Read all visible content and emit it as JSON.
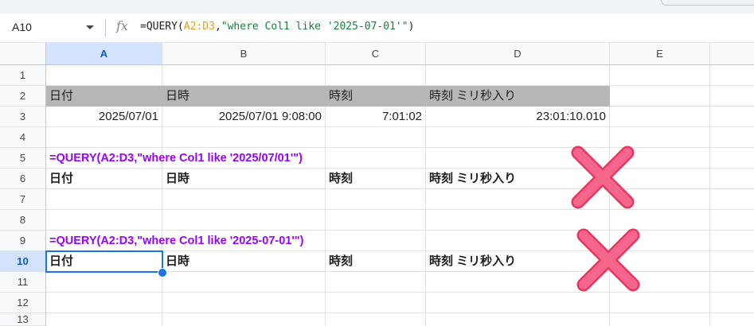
{
  "name_box": "A10",
  "formula_bar": {
    "fx_icon": "fx-icon",
    "prefix": "=QUERY(",
    "range": "A2:D3",
    "comma": ",",
    "query_string": "\"where Col1 like '2025-07-01'\"",
    "suffix": ")"
  },
  "columns": [
    "A",
    "B",
    "C",
    "D",
    "E"
  ],
  "rows": [
    "1",
    "2",
    "3",
    "4",
    "5",
    "6",
    "7",
    "8",
    "9",
    "10",
    "11",
    "12",
    "13"
  ],
  "selected_cell": "A10",
  "cells": {
    "A2": "日付",
    "B2": "日時",
    "C2": "時刻",
    "D2": "時刻 ミリ秒入り",
    "A3": "2025/07/01",
    "B3": "2025/07/01 9:08:00",
    "C3": "7:01:02",
    "D3": "23:01:10.010",
    "A5": "=QUERY(A2:D3,\"where Col1 like '2025/07/01'\")",
    "A6": "日付",
    "B6": "日時",
    "C6": "時刻",
    "D6": "時刻 ミリ秒入り",
    "A9": "=QUERY(A2:D3,\"where Col1 like '2025-07-01'\")",
    "A10": "日付",
    "B10": "日時",
    "C10": "時刻",
    "D10": "時刻 ミリ秒入り"
  },
  "colors": {
    "header_fill": "#b7b7b7",
    "formula_text": "#9900ff",
    "selection": "#1a73e8",
    "cross_mark": "#f0527a"
  },
  "annotations": [
    "cross-mark-icon",
    "cross-mark-icon"
  ]
}
